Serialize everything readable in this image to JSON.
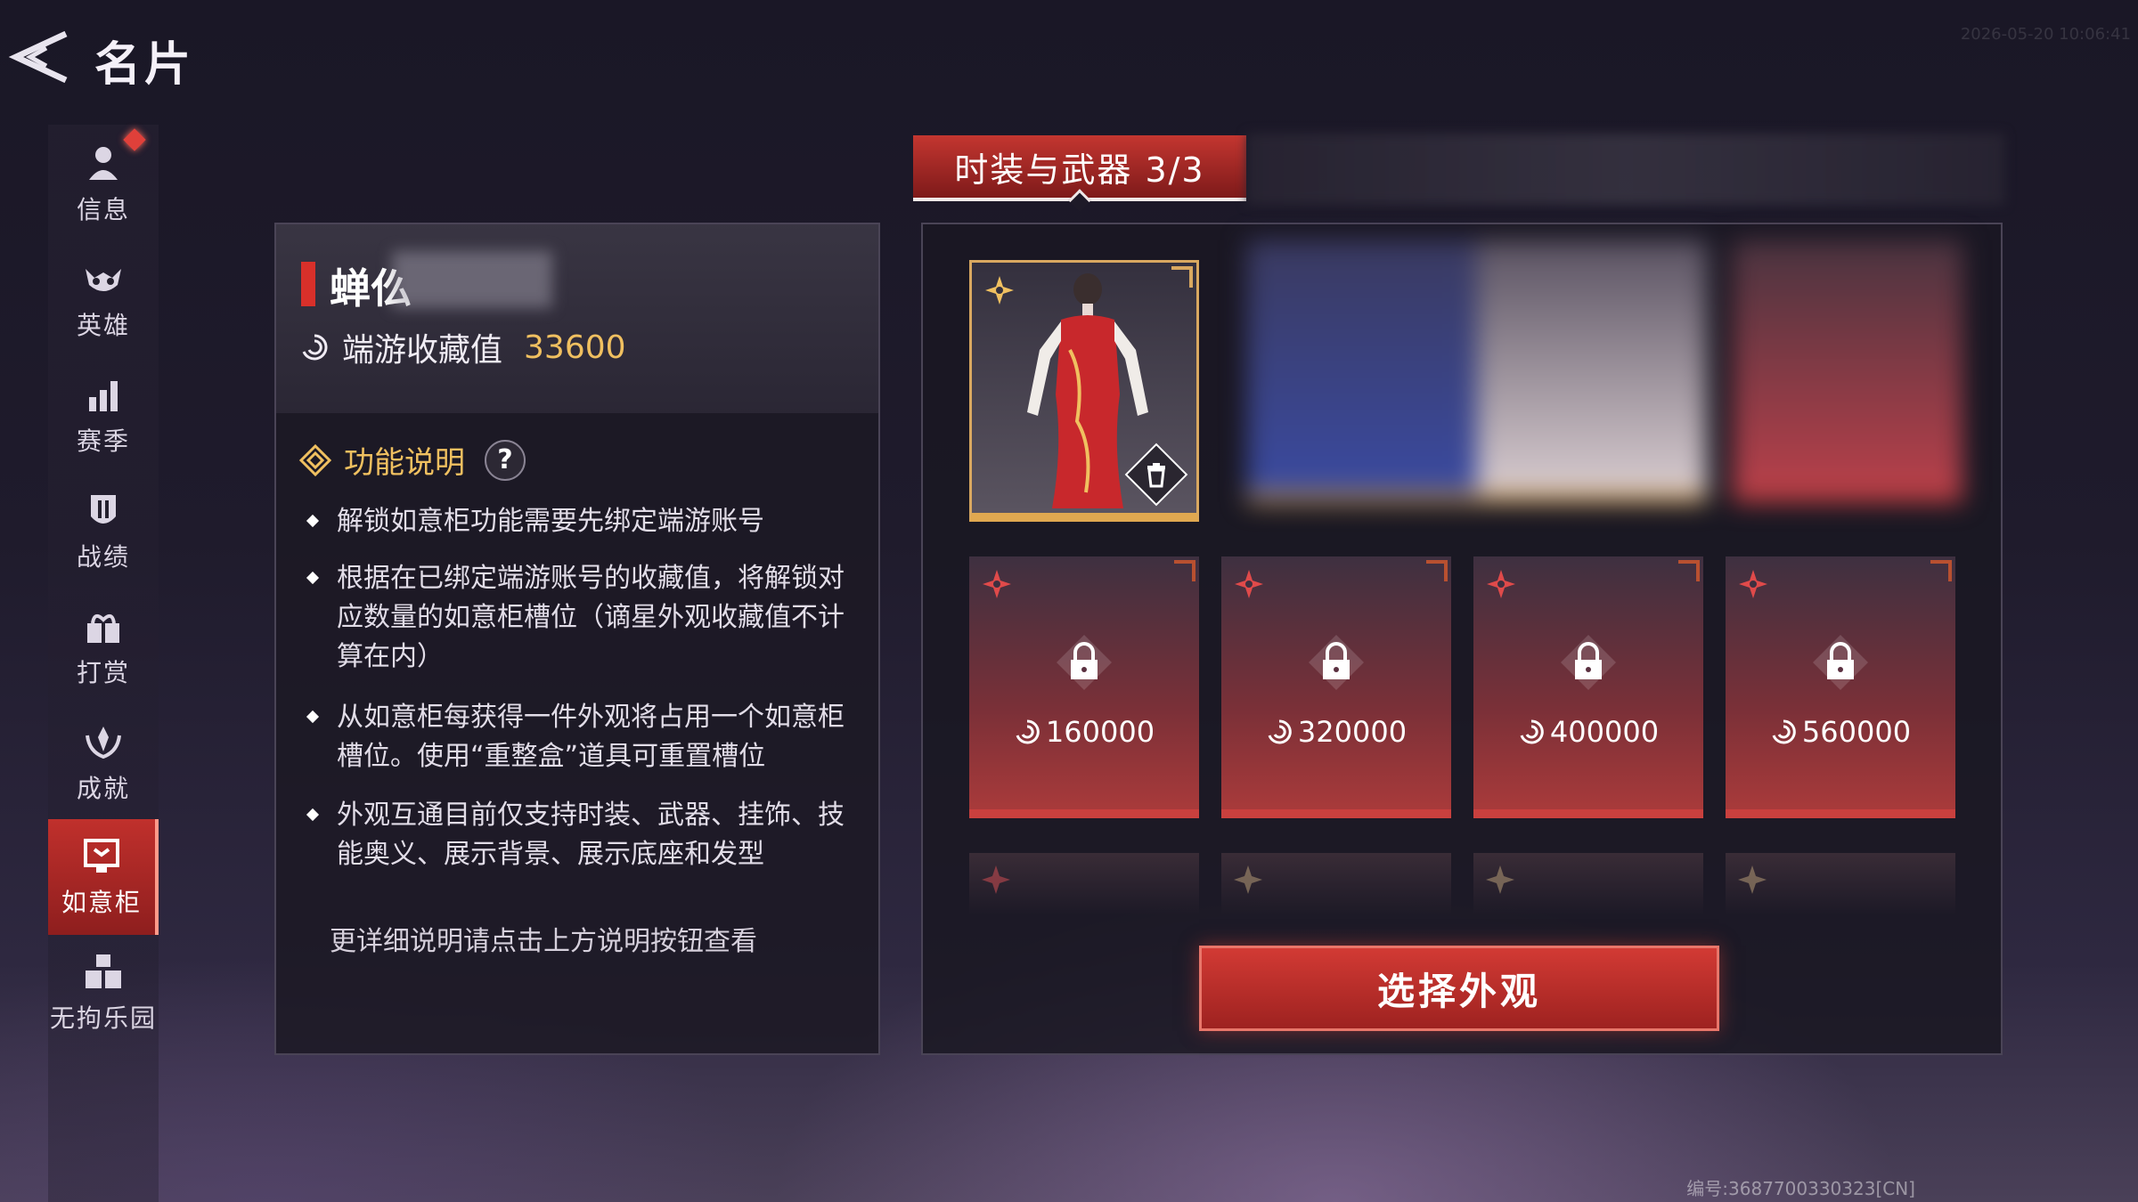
{
  "header": {
    "title": "名片",
    "timestamp": "2026-05-20 10:06:41"
  },
  "sidebar": {
    "items": [
      {
        "label": "信息",
        "icon": "person-icon"
      },
      {
        "label": "英雄",
        "icon": "mask-icon"
      },
      {
        "label": "赛季",
        "icon": "bar-chart-icon"
      },
      {
        "label": "战绩",
        "icon": "shield-icon"
      },
      {
        "label": "打赏",
        "icon": "gift-icon"
      },
      {
        "label": "成就",
        "icon": "laurel-icon"
      },
      {
        "label": "如意柜",
        "icon": "cabinet-icon",
        "active": true
      },
      {
        "label": "无拘乐园",
        "icon": "blocks-icon"
      }
    ]
  },
  "profile": {
    "name": "蝉仫",
    "collection_label": "端游收藏值",
    "collection_value": "33600"
  },
  "info": {
    "title": "功能说明",
    "help": "?",
    "bullets": [
      "解锁如意柜功能需要先绑定端游账号",
      "根据在已绑定端游账号的收藏值，将解锁对应数量的如意柜槽位（谪星外观收藏值不计算在内）",
      "从如意柜每获得一件外观将占用一个如意柜槽位。使用“重整盒”道具可重置槽位",
      "外观互通目前仅支持时装、武器、挂饰、技能奥义、展示背景、展示底座和发型"
    ],
    "more": "更详细说明请点击上方说明按钮查看"
  },
  "tabs": {
    "active_label": "时装与武器 3/3"
  },
  "locked_slots": [
    {
      "cost": "160000"
    },
    {
      "cost": "320000"
    },
    {
      "cost": "400000"
    },
    {
      "cost": "560000"
    }
  ],
  "select_button": "选择外观",
  "footer": {
    "serial": "编号:3687700330323[CN]"
  },
  "colors": {
    "accent_red": "#c43630",
    "gold": "#f0c060",
    "slot_border_gold": "#d9a860"
  }
}
